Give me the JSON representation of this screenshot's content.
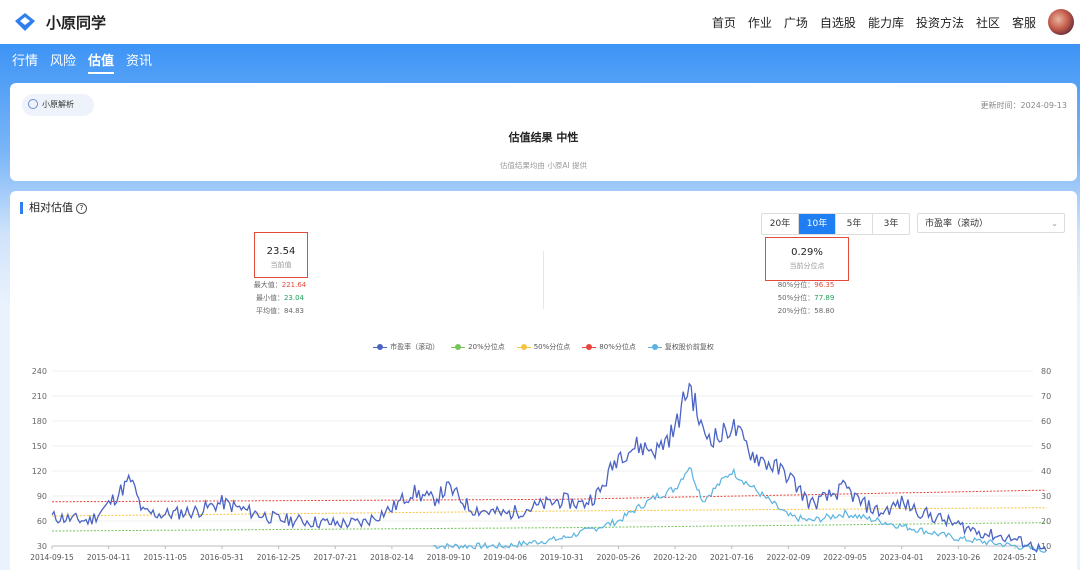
{
  "header": {
    "brand": "小原同学",
    "nav": [
      "首页",
      "作业",
      "广场",
      "自选股",
      "能力库",
      "投资方法",
      "社区",
      "客服"
    ]
  },
  "tabs": [
    {
      "label": "行情",
      "active": false
    },
    {
      "label": "风险",
      "active": false
    },
    {
      "label": "估值",
      "active": true
    },
    {
      "label": "资讯",
      "active": false
    }
  ],
  "analysis": {
    "chip": "小原解析",
    "updated": "更新时间：2024-09-13",
    "result": "估值结果  中性",
    "note": "估值结果均由 小原AI 提供"
  },
  "relative": {
    "title": "相对估值",
    "periods": [
      {
        "label": "20年",
        "active": false
      },
      {
        "label": "10年",
        "active": true
      },
      {
        "label": "5年",
        "active": false
      },
      {
        "label": "3年",
        "active": false
      }
    ],
    "metric": "市盈率（滚动）",
    "current_value": "23.54",
    "current_label": "当前值",
    "max_label": "最大值：",
    "max_value": "221.64",
    "min_label": "最小值：",
    "min_value": "23.04",
    "avg_label": "平均值：",
    "avg_value": "84.83",
    "percentile_value": "0.29%",
    "percentile_label": "当前分位点",
    "p80_label": "80%分位：",
    "p80_value": "96.35",
    "p50_label": "50%分位：",
    "p50_value": "77.89",
    "p20_label": "20%分位：",
    "p20_value": "58.80"
  },
  "colors": {
    "pe": "#4a63c4",
    "p20": "#75c45a",
    "p50": "#f5c542",
    "p80": "#e8453c",
    "price": "#5ab4e0",
    "accent": "#1e7ef2"
  },
  "chart_data": {
    "type": "line",
    "legend": [
      "市盈率（滚动）",
      "20%分位点",
      "50%分位点",
      "80%分位点",
      "复权股价前复权"
    ],
    "x_ticks": [
      "2014-09-15",
      "2015-04-11",
      "2015-11-05",
      "2016-05-31",
      "2016-12-25",
      "2017-07-21",
      "2018-02-14",
      "2018-09-10",
      "2019-04-06",
      "2019-10-31",
      "2020-05-26",
      "2020-12-20",
      "2021-07-16",
      "2022-02-09",
      "2022-09-05",
      "2023-04-01",
      "2023-10-26",
      "2024-05-21"
    ],
    "y_left": {
      "ticks": [
        30,
        60,
        90,
        120,
        150,
        180,
        210,
        240
      ],
      "range": [
        30,
        240
      ]
    },
    "y_right": {
      "ticks": [
        10,
        20,
        30,
        40,
        50,
        60,
        70,
        80
      ],
      "range": [
        10,
        80
      ]
    },
    "series": [
      {
        "name": "市盈率（滚动）",
        "axis": "left",
        "x": [
          "2014-09-15",
          "2015-02-01",
          "2015-04-11",
          "2015-07-01",
          "2015-08-15",
          "2015-11-05",
          "2016-03-01",
          "2016-05-31",
          "2016-09-01",
          "2016-12-25",
          "2017-04-01",
          "2017-07-21",
          "2017-11-01",
          "2018-02-14",
          "2018-05-01",
          "2018-07-15",
          "2018-09-10",
          "2018-12-01",
          "2019-04-06",
          "2019-07-01",
          "2019-10-31",
          "2020-01-15",
          "2020-03-20",
          "2020-05-26",
          "2020-08-01",
          "2020-10-15",
          "2020-12-20",
          "2021-02-10",
          "2021-04-01",
          "2021-06-01",
          "2021-07-16",
          "2021-10-01",
          "2022-02-09",
          "2022-05-01",
          "2022-07-01",
          "2022-09-05",
          "2022-11-01",
          "2023-01-15",
          "2023-04-01",
          "2023-07-01",
          "2023-10-26",
          "2024-02-01",
          "2024-05-21",
          "2024-09-13"
        ],
        "values": [
          65,
          60,
          80,
          110,
          70,
          68,
          72,
          82,
          72,
          62,
          60,
          57,
          58,
          75,
          95,
          85,
          100,
          75,
          68,
          75,
          85,
          80,
          95,
          140,
          150,
          145,
          170,
          225,
          165,
          160,
          175,
          140,
          115,
          80,
          88,
          100,
          82,
          70,
          82,
          68,
          55,
          45,
          38,
          24
        ]
      },
      {
        "name": "20%分位点",
        "axis": "left",
        "x": [
          "2014-09-15",
          "2019-10-31",
          "2024-09-13"
        ],
        "values": [
          48,
          52,
          58
        ]
      },
      {
        "name": "50%分位点",
        "axis": "left",
        "x": [
          "2014-09-15",
          "2019-10-31",
          "2024-09-13"
        ],
        "values": [
          66,
          72,
          76
        ]
      },
      {
        "name": "80%分位点",
        "axis": "left",
        "x": [
          "2014-09-15",
          "2019-10-31",
          "2024-09-13"
        ],
        "values": [
          83,
          86,
          97
        ]
      },
      {
        "name": "复权股价前复权",
        "axis": "right",
        "x": [
          "2018-07-15",
          "2019-04-06",
          "2019-10-31",
          "2020-05-26",
          "2020-08-01",
          "2020-10-15",
          "2020-12-20",
          "2021-02-10",
          "2021-04-01",
          "2021-07-16",
          "2022-02-09",
          "2022-05-01",
          "2022-09-05",
          "2023-04-01",
          "2023-10-26",
          "2024-05-21",
          "2024-09-13"
        ],
        "values": [
          10,
          10,
          13,
          20,
          25,
          30,
          33,
          42,
          28,
          40,
          22,
          20,
          23,
          18,
          13,
          10,
          8
        ]
      }
    ]
  }
}
